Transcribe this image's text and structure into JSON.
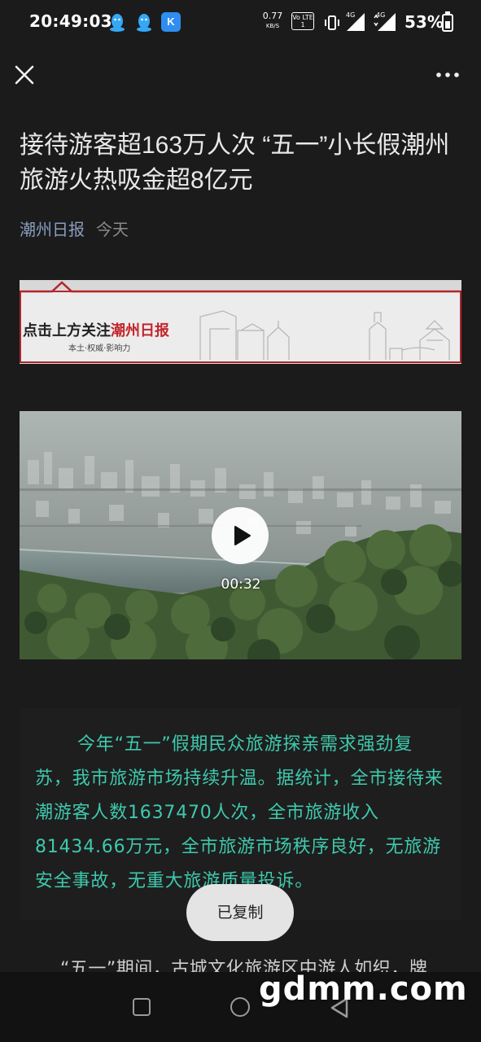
{
  "status_bar": {
    "time": "20:49:03",
    "net_speed": "0.77",
    "net_speed_unit": "KB/S",
    "volte": "Vo LTE 1",
    "signal_1": "4G",
    "signal_2": "4G",
    "battery": "53%"
  },
  "article": {
    "title": "接待游客超163万人次 “五一”小长假潮州旅游火热吸金超8亿元",
    "source": "潮州日报",
    "date": "今天"
  },
  "banner": {
    "main_prefix": "点击上方关注",
    "main_brand": "潮州日报",
    "sub": "本土·权威·影响力"
  },
  "video": {
    "duration": "00:32"
  },
  "quote": {
    "text": "今年“五一”假期民众旅游探亲需求强劲复苏，我市旅游市场持续升温。据统计，全市接待来潮游客人数1637470人次，全市旅游收入81434.66万元，全市旅游市场秩序良好，无旅游安全事故，无重大旅游质量投诉。"
  },
  "toast": "已复制",
  "next_paragraph": "“五一”期间，古城文化旅游区中游人如织，牌",
  "watermark": "gdmm.com",
  "colors": {
    "accent_teal": "#3ec9ad",
    "source_blue": "#8a9dc0",
    "banner_red": "#c0262b"
  }
}
